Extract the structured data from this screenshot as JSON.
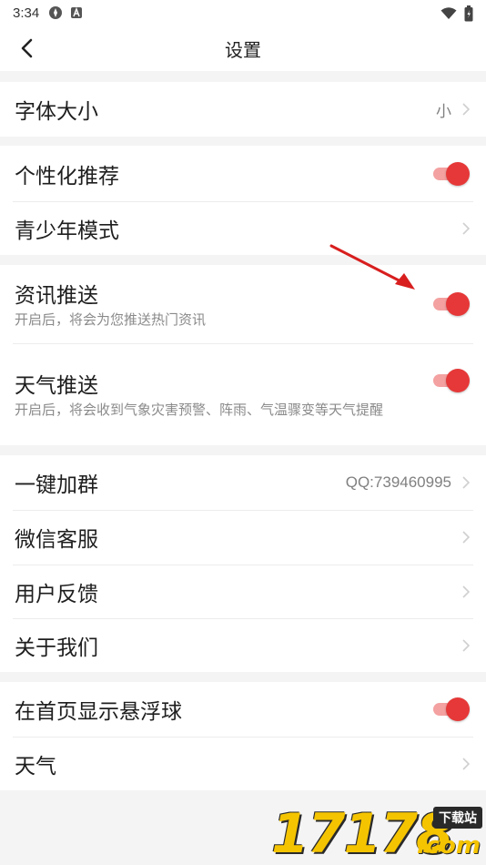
{
  "status_bar": {
    "time": "3:34"
  },
  "header": {
    "title": "设置"
  },
  "groups": [
    {
      "items": [
        {
          "label": "字体大小",
          "value": "小"
        }
      ]
    },
    {
      "items": [
        {
          "label": "个性化推荐",
          "toggle": true
        },
        {
          "label": "青少年模式"
        }
      ]
    },
    {
      "items": [
        {
          "label": "资讯推送",
          "sub": "开启后，将会为您推送热门资讯",
          "toggle": true
        },
        {
          "label": "天气推送",
          "sub": "开启后，将会收到气象灾害预警、阵雨、气温骤变等天气提醒",
          "toggle": true
        }
      ]
    },
    {
      "items": [
        {
          "label": "一键加群",
          "value": "QQ:739460995"
        },
        {
          "label": "微信客服"
        },
        {
          "label": "用户反馈"
        },
        {
          "label": "关于我们"
        }
      ]
    },
    {
      "items": [
        {
          "label": "在首页显示悬浮球",
          "toggle": true
        },
        {
          "label": "天气"
        }
      ]
    }
  ],
  "watermark": {
    "digits": "17178",
    "badge": "下载站",
    "domain": ".com"
  },
  "colors": {
    "accent": "#e63838",
    "accent_track": "#f4a1a1",
    "background": "#f4f4f4"
  },
  "icons": [
    "back-arrow-icon",
    "chevron-right-icon",
    "wifi-icon",
    "battery-icon",
    "red-pointer-arrow"
  ]
}
